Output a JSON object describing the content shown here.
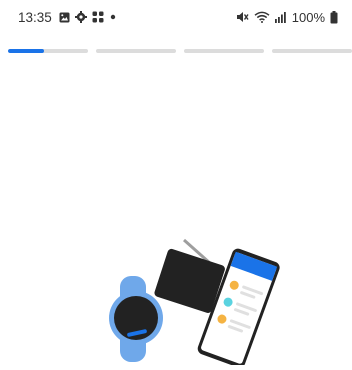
{
  "status_bar": {
    "time": "13:35",
    "left_icons": [
      "image-icon",
      "gear-icon",
      "apps-grid-icon",
      "dot-icon"
    ],
    "right_icons": [
      "mute-icon",
      "wifi-icon",
      "signal-icon"
    ],
    "battery_percent": "100%",
    "battery_level": 1.0
  },
  "progress": {
    "steps": 4,
    "current_step": 1,
    "current_step_fill": 0.45,
    "active_color": "#1a73e8",
    "inactive_color": "#dcdcdc"
  },
  "illustration": {
    "items": [
      "watch-icon",
      "tablet-icon",
      "phone-icon"
    ],
    "colors": {
      "watch_band": "#6fa8ea",
      "screen_dark": "#222222",
      "phone_header": "#1a73e8",
      "dot_orange": "#f5b342",
      "dot_cyan": "#5ad3e0"
    }
  }
}
